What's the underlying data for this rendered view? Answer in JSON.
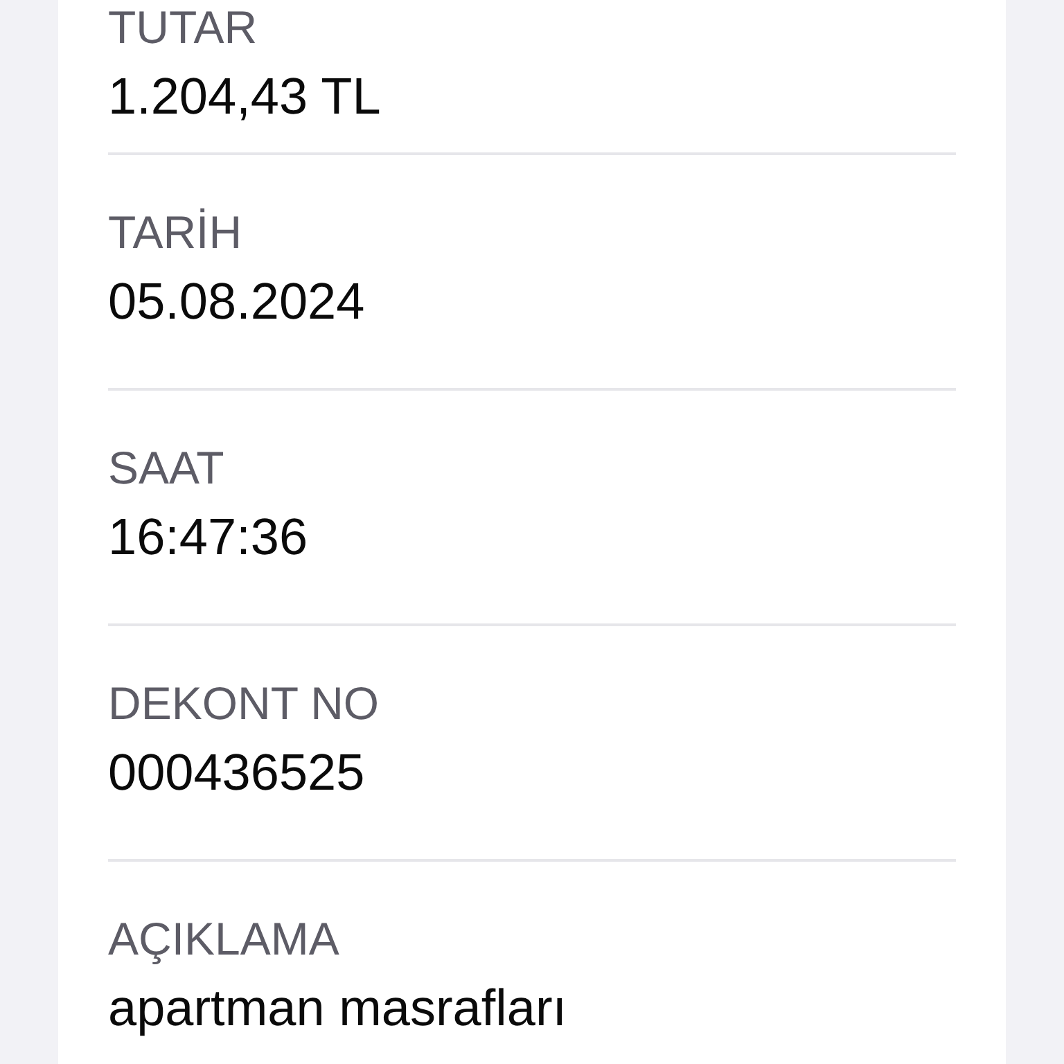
{
  "fields": [
    {
      "label": "TUTAR",
      "value": "1.204,43 TL"
    },
    {
      "label": "TARİH",
      "value": "05.08.2024"
    },
    {
      "label": "SAAT",
      "value": "16:47:36"
    },
    {
      "label": "DEKONT NO",
      "value": "000436525"
    },
    {
      "label": "AÇIKLAMA",
      "value": "apartman masrafları"
    }
  ]
}
